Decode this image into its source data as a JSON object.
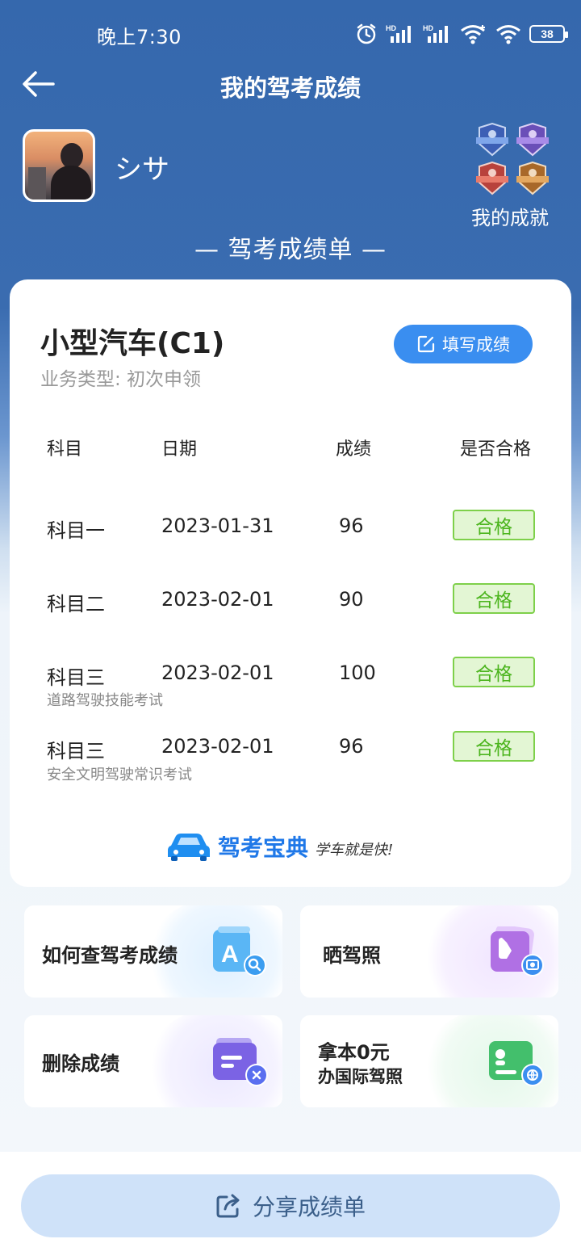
{
  "status_bar": {
    "time": "晚上7:30",
    "battery": "38"
  },
  "header": {
    "title": "我的驾考成绩"
  },
  "profile": {
    "username": "シサ",
    "achievements_label": "我的成就"
  },
  "section_title": "— 驾考成绩单 —",
  "card": {
    "license_type": "小型汽车(C1)",
    "business_type": "业务类型: 初次申领",
    "fill_button": "填写成绩",
    "columns": [
      "科目",
      "日期",
      "成绩",
      "是否合格"
    ],
    "rows": [
      {
        "subject": "科目一",
        "date": "2023-01-31",
        "score": "96",
        "result": "合格",
        "note": ""
      },
      {
        "subject": "科目二",
        "date": "2023-02-01",
        "score": "90",
        "result": "合格",
        "note": ""
      },
      {
        "subject": "科目三",
        "date": "2023-02-01",
        "score": "100",
        "result": "合格",
        "note": "道路驾驶技能考试"
      },
      {
        "subject": "科目三",
        "date": "2023-02-01",
        "score": "96",
        "result": "合格",
        "note": "安全文明驾驶常识考试"
      }
    ],
    "brand_name": "驾考宝典",
    "brand_slogan": "学车就是快!"
  },
  "tools": [
    {
      "label": "如何查驾考成绩",
      "icon": "search-doc-icon",
      "color": "#4aa8f0"
    },
    {
      "label": "晒驾照",
      "icon": "photo-share-icon",
      "color": "#b272e6"
    },
    {
      "label": "删除成绩",
      "icon": "delete-doc-icon",
      "color": "#7d64e6"
    },
    {
      "label_line1": "拿本0元",
      "label_line2": "办国际驾照",
      "icon": "license-globe-icon",
      "color": "#3fc06a"
    }
  ],
  "share_button": "分享成绩单"
}
